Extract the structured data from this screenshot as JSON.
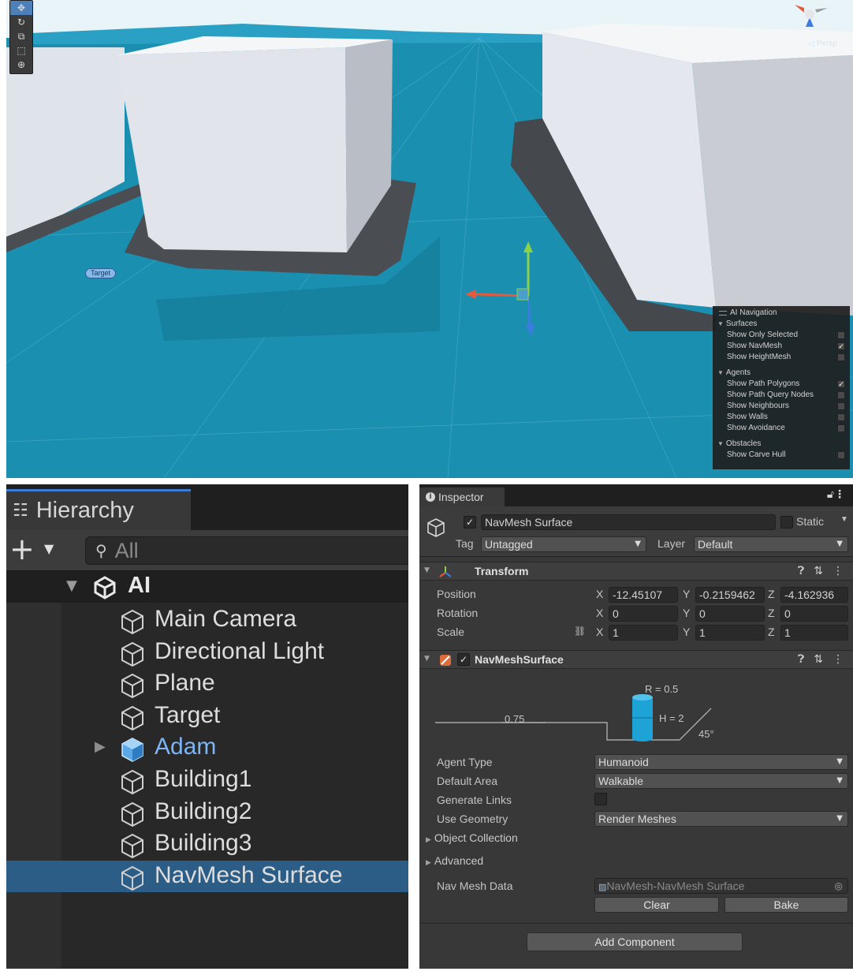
{
  "scene": {
    "target_label": "Target",
    "persp_label": "◁ Persp",
    "toolbar_icons": [
      "move-tool-icon",
      "rotate-tool-icon",
      "scale-tool-icon",
      "rect-tool-icon",
      "transform-tool-icon"
    ],
    "colors": {
      "navmesh": "#1b8fb0",
      "building": "#dfe3ea",
      "shadow": "#4a4d52",
      "sky": "#e8f4f8"
    },
    "ai_navigation": {
      "title": "AI Navigation",
      "sections": [
        {
          "name": "Surfaces",
          "items": [
            {
              "label": "Show Only Selected",
              "checked": false
            },
            {
              "label": "Show NavMesh",
              "checked": true
            },
            {
              "label": "Show HeightMesh",
              "checked": false
            }
          ]
        },
        {
          "name": "Agents",
          "items": [
            {
              "label": "Show Path Polygons",
              "checked": true
            },
            {
              "label": "Show Path Query Nodes",
              "checked": false
            },
            {
              "label": "Show Neighbours",
              "checked": false
            },
            {
              "label": "Show Walls",
              "checked": false
            },
            {
              "label": "Show Avoidance",
              "checked": false
            }
          ]
        },
        {
          "name": "Obstacles",
          "items": [
            {
              "label": "Show Carve Hull",
              "checked": false
            }
          ]
        }
      ]
    }
  },
  "hierarchy": {
    "tab_title": "Hierarchy",
    "add_label": "+",
    "search_placeholder": "All",
    "scene_name": "AI",
    "items": [
      {
        "label": "Main Camera",
        "prefab": false,
        "selected": false
      },
      {
        "label": "Directional Light",
        "prefab": false,
        "selected": false
      },
      {
        "label": "Plane",
        "prefab": false,
        "selected": false
      },
      {
        "label": "Target",
        "prefab": false,
        "selected": false
      },
      {
        "label": "Adam",
        "prefab": true,
        "selected": false
      },
      {
        "label": "Building1",
        "prefab": false,
        "selected": false
      },
      {
        "label": "Building2",
        "prefab": false,
        "selected": false
      },
      {
        "label": "Building3",
        "prefab": false,
        "selected": false
      },
      {
        "label": "NavMesh Surface",
        "prefab": false,
        "selected": true
      }
    ]
  },
  "inspector": {
    "tab_title": "Inspector",
    "object_name": "NavMesh Surface",
    "static_label": "Static",
    "tag_label": "Tag",
    "tag_value": "Untagged",
    "layer_label": "Layer",
    "layer_value": "Default",
    "transform": {
      "title": "Transform",
      "position_label": "Position",
      "rotation_label": "Rotation",
      "scale_label": "Scale",
      "position": {
        "x": "-12.45107",
        "y": "-0.2159462",
        "z": "-4.162936"
      },
      "rotation": {
        "x": "0",
        "y": "0",
        "z": "0"
      },
      "scale": {
        "x": "1",
        "y": "1",
        "z": "1"
      }
    },
    "navmesh_surface": {
      "title": "NavMeshSurface",
      "agent_radius_label": "R = 0.5",
      "agent_height_label": "H = 2",
      "step_label": "0.75",
      "slope_label": "45°",
      "agent_type_label": "Agent Type",
      "agent_type_value": "Humanoid",
      "default_area_label": "Default Area",
      "default_area_value": "Walkable",
      "generate_links_label": "Generate Links",
      "use_geometry_label": "Use Geometry",
      "use_geometry_value": "Render Meshes",
      "object_collection_label": "Object Collection",
      "advanced_label": "Advanced",
      "nav_mesh_data_label": "Nav Mesh Data",
      "nav_mesh_data_value": "NavMesh-NavMesh Surface",
      "clear_label": "Clear",
      "bake_label": "Bake"
    },
    "add_component_label": "Add Component",
    "axis": {
      "x": "X",
      "y": "Y",
      "z": "Z"
    }
  }
}
